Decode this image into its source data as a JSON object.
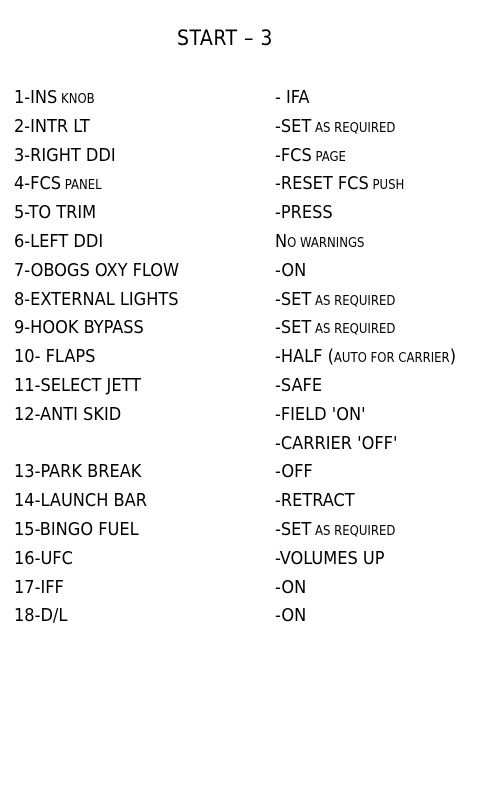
{
  "title": "START – 3",
  "rows": [
    {
      "item": "1-INS",
      "item_small": " KNOB",
      "action": "- IFA",
      "action_small": ""
    },
    {
      "item": "2-INTR LT",
      "item_small": "",
      "action": "-SET",
      "action_small": " AS REQUIRED"
    },
    {
      "item": "3-RIGHT DDI",
      "item_small": "",
      "action": "-FCS",
      "action_small": " PAGE"
    },
    {
      "item": "4-FCS",
      "item_small": " PANEL",
      "action": "-RESET FCS",
      "action_small": " PUSH"
    },
    {
      "item": "5-TO TRIM",
      "item_small": "",
      "action": "-PRESS",
      "action_small": ""
    },
    {
      "item": "6-LEFT DDI",
      "item_small": "",
      "action": "N",
      "action_small": "O WARNINGS"
    },
    {
      "item": "7-OBOGS OXY FLOW",
      "item_small": "",
      "action": "-ON",
      "action_small": ""
    },
    {
      "item": "8-EXTERNAL LIGHTS",
      "item_small": "",
      "action": "-SET",
      "action_small": " AS REQUIRED"
    },
    {
      "item": "9-HOOK BYPASS",
      "item_small": "",
      "action": "-SET",
      "action_small": " AS REQUIRED"
    },
    {
      "item": "10- FLAPS",
      "item_small": "",
      "action": "-HALF (",
      "action_small": "AUTO FOR CARRIER",
      "action_end": ")"
    },
    {
      "item": "11-SELECT JETT",
      "item_small": "",
      "action": "-SAFE",
      "action_small": ""
    },
    {
      "item": "12-ANTI SKID",
      "item_small": "",
      "action": "-FIELD 'ON'",
      "action_small": ""
    },
    {
      "item": "",
      "item_small": "",
      "action": "-CARRIER 'OFF'",
      "action_small": ""
    },
    {
      "item": "13-PARK BREAK",
      "item_small": "",
      "action": "-OFF",
      "action_small": ""
    },
    {
      "item": "14-LAUNCH BAR",
      "item_small": "",
      "action": "-RETRACT",
      "action_small": ""
    },
    {
      "item": "15-BINGO FUEL",
      "item_small": "",
      "action": "-SET",
      "action_small": " AS REQUIRED"
    },
    {
      "item": "16-UFC",
      "item_small": "",
      "action": "-VOLUMES UP",
      "action_small": ""
    },
    {
      "item": "17-IFF",
      "item_small": "",
      "action": "-ON",
      "action_small": ""
    },
    {
      "item": "18-D/L",
      "item_small": "",
      "action": "-ON",
      "action_small": ""
    }
  ]
}
